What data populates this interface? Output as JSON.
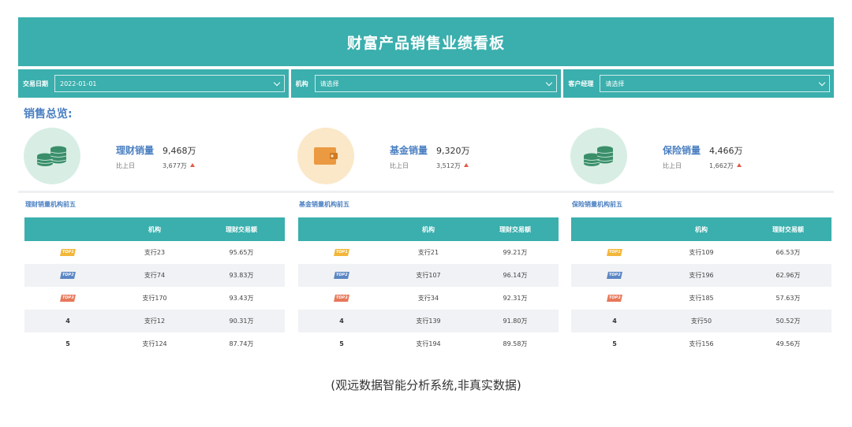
{
  "header": {
    "title": "财富产品销售业绩看板"
  },
  "filters": [
    {
      "label": "交易日期",
      "value": "2022-01-01"
    },
    {
      "label": "机构",
      "value": "请选择"
    },
    {
      "label": "客户经理",
      "value": "请选择"
    }
  ],
  "overview": {
    "title": "销售总览:",
    "cards": [
      {
        "name": "理财销量",
        "value": "9,468万",
        "compare_label": "比上日",
        "compare_value": "3,677万",
        "icon": "coin-stack-icon"
      },
      {
        "name": "基金销量",
        "value": "9,320万",
        "compare_label": "比上日",
        "compare_value": "3,512万",
        "icon": "wallet-icon"
      },
      {
        "name": "保险销量",
        "value": "4,466万",
        "compare_label": "比上日",
        "compare_value": "1,662万",
        "icon": "coin-stack-icon"
      }
    ]
  },
  "panels": [
    {
      "title": "理财销量机构前五",
      "headers": [
        "",
        "机构",
        "理财交易额"
      ],
      "rows": [
        {
          "rank": "TOP1",
          "org": "支行23",
          "amount": "95.65万"
        },
        {
          "rank": "TOP2",
          "org": "支行74",
          "amount": "93.83万"
        },
        {
          "rank": "TOP3",
          "org": "支行170",
          "amount": "93.43万"
        },
        {
          "rank": "4",
          "org": "支行12",
          "amount": "90.31万"
        },
        {
          "rank": "5",
          "org": "支行124",
          "amount": "87.74万"
        }
      ]
    },
    {
      "title": "基金销量机构前五",
      "headers": [
        "",
        "机构",
        "理财交易额"
      ],
      "rows": [
        {
          "rank": "TOP1",
          "org": "支行21",
          "amount": "99.21万"
        },
        {
          "rank": "TOP2",
          "org": "支行107",
          "amount": "96.14万"
        },
        {
          "rank": "TOP3",
          "org": "支行34",
          "amount": "92.31万"
        },
        {
          "rank": "4",
          "org": "支行139",
          "amount": "91.80万"
        },
        {
          "rank": "5",
          "org": "支行194",
          "amount": "89.58万"
        }
      ]
    },
    {
      "title": "保险销量机构前五",
      "headers": [
        "",
        "机构",
        "理财交易额"
      ],
      "rows": [
        {
          "rank": "TOP1",
          "org": "支行109",
          "amount": "66.53万"
        },
        {
          "rank": "TOP2",
          "org": "支行196",
          "amount": "62.96万"
        },
        {
          "rank": "TOP3",
          "org": "支行185",
          "amount": "57.63万"
        },
        {
          "rank": "4",
          "org": "支行50",
          "amount": "50.52万"
        },
        {
          "rank": "5",
          "org": "支行156",
          "amount": "49.56万"
        }
      ]
    }
  ],
  "colors": {
    "accent": "#3aafad",
    "title_blue": "#4a7fc1",
    "top1": "#f2b638",
    "top2": "#5b86c4",
    "top3": "#e7785a",
    "up": "#e05c4a"
  },
  "footer": {
    "caption": "(观远数据智能分析系统,非真实数据)"
  }
}
